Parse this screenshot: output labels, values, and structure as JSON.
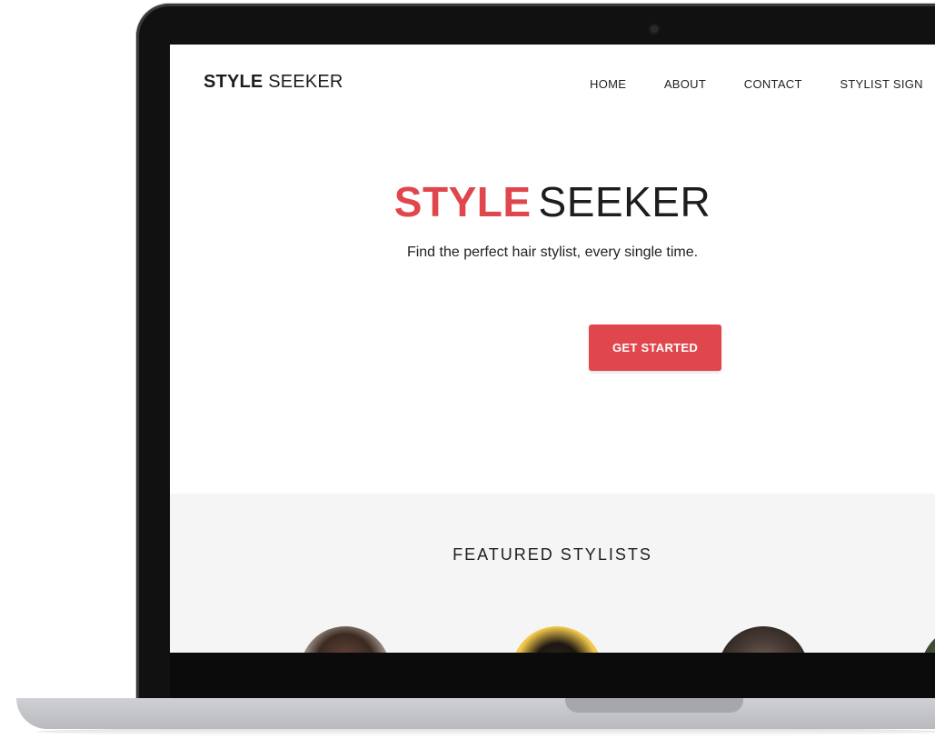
{
  "site": {
    "logo_bold": "STYLE",
    "logo_rest": "SEEKER"
  },
  "nav": {
    "items": [
      {
        "label": "HOME"
      },
      {
        "label": "ABOUT"
      },
      {
        "label": "CONTACT"
      },
      {
        "label": "STYLIST SIGN"
      }
    ]
  },
  "hero": {
    "title_accent": "STYLE",
    "title_rest": "SEEKER",
    "subtitle": "Find the perfect hair stylist, every single time.",
    "cta_label": "GET STARTED"
  },
  "featured": {
    "title": "FEATURED STYLISTS",
    "stylists": [
      {
        "avatar": "stylist-photo"
      },
      {
        "avatar": "stylist-photo"
      },
      {
        "avatar": "stylist-photo"
      },
      {
        "avatar": "stylist-photo"
      }
    ]
  },
  "colors": {
    "accent": "#e0474c",
    "text": "#1d1d1d",
    "section_bg": "#f5f5f5"
  }
}
